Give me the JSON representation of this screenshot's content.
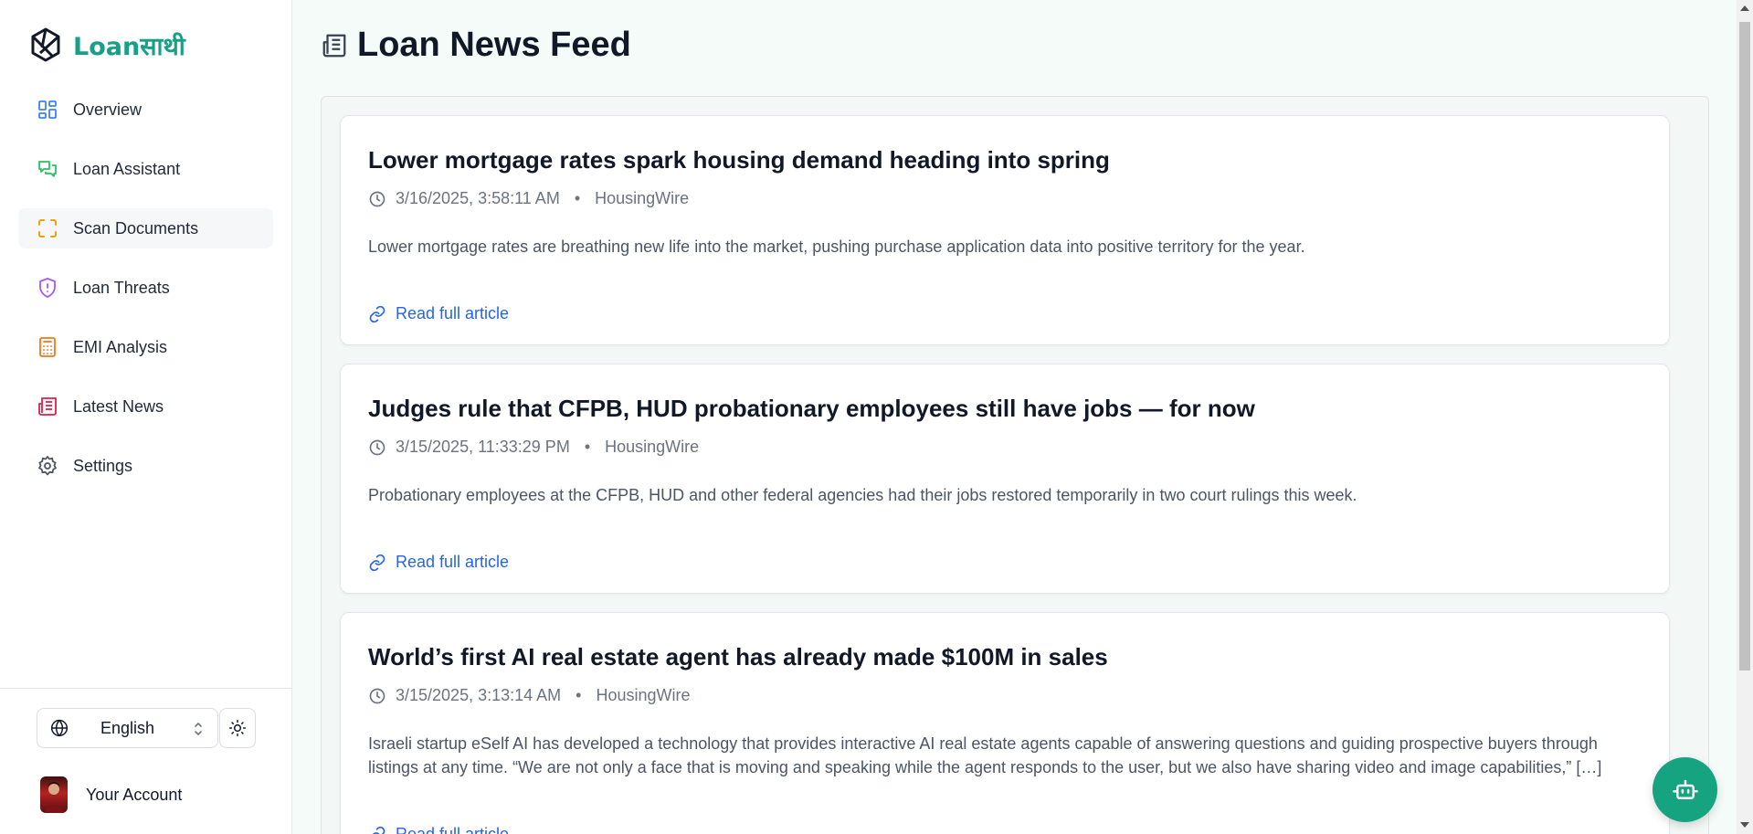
{
  "app": {
    "name": "Loanसाथी",
    "brand_color": "#16a085"
  },
  "sidebar": {
    "items": [
      {
        "label": "Overview",
        "icon": "layout-grid-icon",
        "color": "#3b82f6"
      },
      {
        "label": "Loan Assistant",
        "icon": "chat-bubbles-icon",
        "color": "#22c55e"
      },
      {
        "label": "Scan Documents",
        "icon": "scan-frame-icon",
        "color": "#f59e0b",
        "active": true
      },
      {
        "label": "Loan Threats",
        "icon": "shield-alert-icon",
        "color": "#a855f7"
      },
      {
        "label": "EMI Analysis",
        "icon": "calculator-icon",
        "color": "#f97316"
      },
      {
        "label": "Latest News",
        "icon": "newspaper-icon",
        "color": "#e11d48"
      },
      {
        "label": "Settings",
        "icon": "gear-icon",
        "color": "#4b5563"
      }
    ],
    "language": {
      "selected": "English"
    },
    "account": {
      "label": "Your Account"
    }
  },
  "main": {
    "title": "Loan News Feed",
    "articles": [
      {
        "title": "Lower mortgage rates spark housing demand heading into spring",
        "timestamp": "3/16/2025, 3:58:11 AM",
        "source": "HousingWire",
        "summary": "Lower mortgage rates are breathing new life into the market, pushing purchase application data into positive territory for the year.",
        "link_label": "Read full article"
      },
      {
        "title": "Judges rule that CFPB, HUD probationary employees still have jobs — for now",
        "timestamp": "3/15/2025, 11:33:29 PM",
        "source": "HousingWire",
        "summary": "Probationary employees at the CFPB, HUD and other federal agencies had their jobs restored temporarily in two court rulings this week.",
        "link_label": "Read full article"
      },
      {
        "title": "World’s first AI real estate agent has already made $100M in sales",
        "timestamp": "3/15/2025, 3:13:14 AM",
        "source": "HousingWire",
        "summary": "Israeli startup eSelf AI has developed a technology that provides interactive AI real estate agents capable of answering questions and guiding prospective buyers through listings at any time. “We are not only a face that is moving and speaking while the agent responds to the user, but we also have sharing video and image capabilities,” […]",
        "link_label": "Read full article"
      }
    ],
    "separator": "•"
  },
  "fab": {
    "icon": "robot-icon",
    "color": "#16a37f"
  }
}
